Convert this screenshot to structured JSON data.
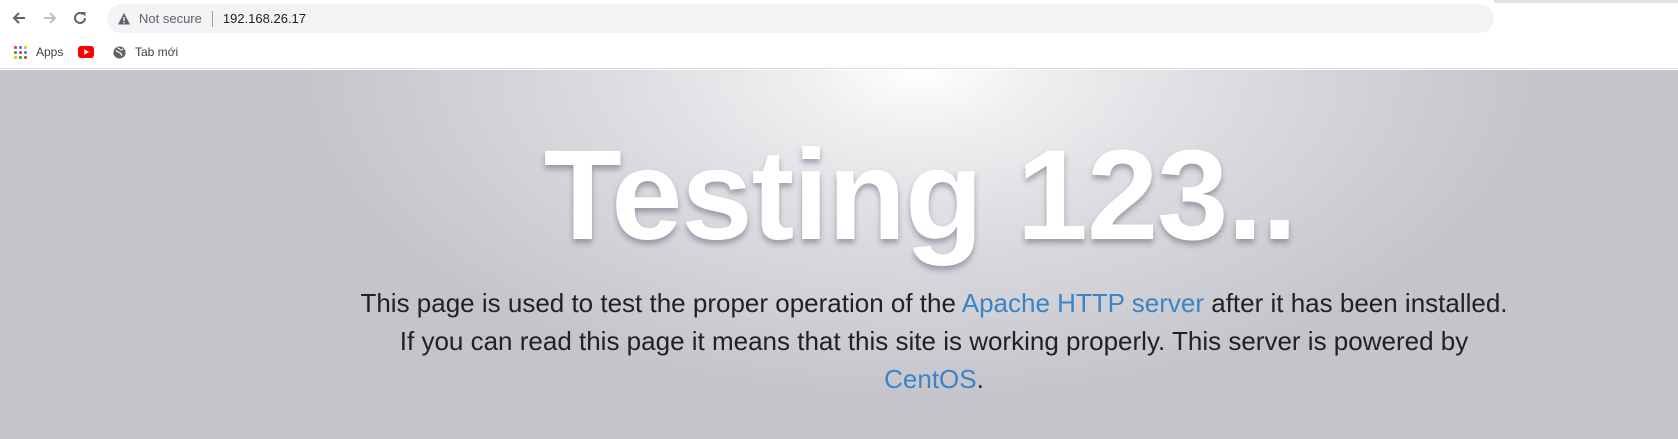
{
  "browser": {
    "security_label": "Not secure",
    "url": "192.168.26.17"
  },
  "bookmarks": {
    "items": [
      {
        "label": "Apps",
        "icon": "apps-grid-icon"
      },
      {
        "label": "",
        "icon": "youtube-icon"
      },
      {
        "label": "Tab mới",
        "icon": "globe-icon"
      }
    ]
  },
  "page": {
    "heading": "Testing 123..",
    "lead_part1": "This page is used to test the proper operation of the ",
    "lead_link1": "Apache HTTP server",
    "lead_part2": " after it has been installed. If you can read this page it means that this site is working properly. This server is powered by ",
    "lead_link2": "CentOS",
    "lead_part3": "."
  },
  "colors": {
    "link": "#3c84c8",
    "heading": "#ffffff",
    "text": "#222222"
  }
}
